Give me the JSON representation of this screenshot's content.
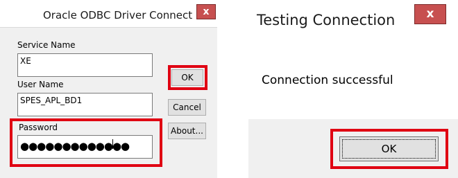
{
  "odbc_dialog": {
    "title": "Oracle ODBC Driver Connect",
    "close_glyph": "x",
    "service_name_label": "Service Name",
    "service_name_value": "XE",
    "user_name_label": "User Name",
    "user_name_value": "SPES_APL_BD1",
    "password_label": "Password",
    "password_masked": "●●●●●●●●●●●●●",
    "ok_label": "OK",
    "cancel_label": "Cancel",
    "about_label": "About..."
  },
  "test_dialog": {
    "title": "Testing Connection",
    "close_glyph": "x",
    "message": "Connection successful",
    "ok_label": "OK"
  },
  "colors": {
    "highlight": "#e00012",
    "close_button": "#c75050",
    "dialog_face": "#f0f0f0"
  },
  "icons": [
    "close-icon"
  ]
}
